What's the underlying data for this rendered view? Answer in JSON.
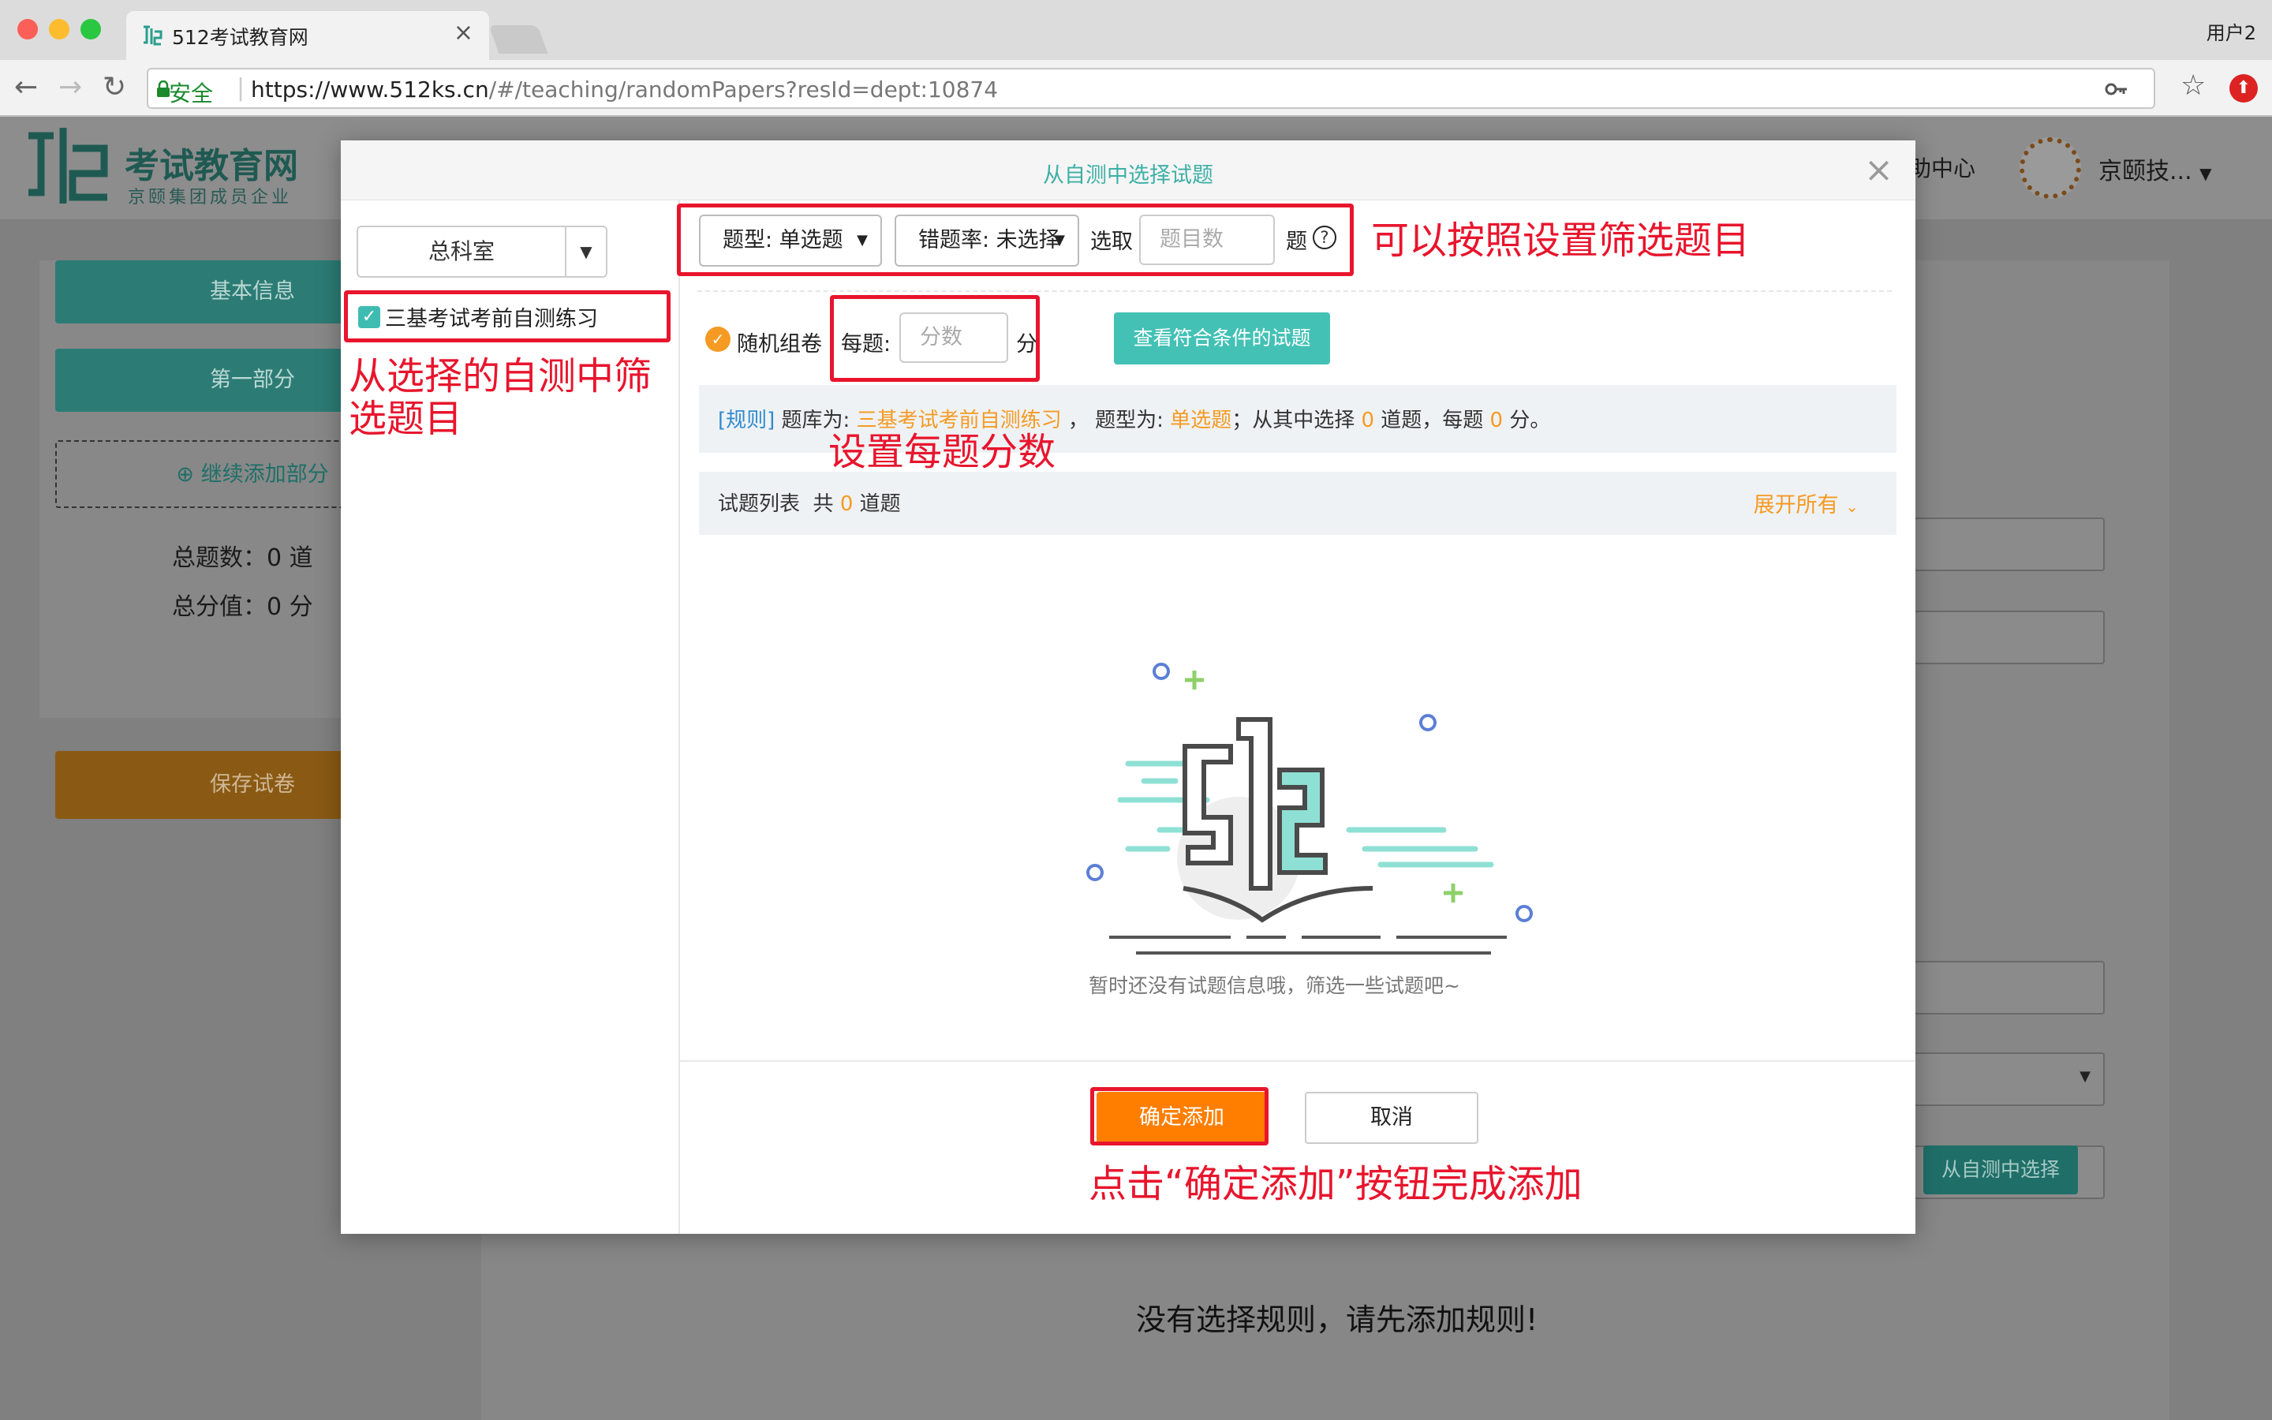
{
  "browser": {
    "tab_title": "512考试教育网",
    "user_label": "用户2",
    "secure_label": "安全",
    "url_host": "https://www.512ks.cn",
    "url_path": "/#/teaching/randomPapers?resId=dept:10874"
  },
  "header": {
    "logo_title": "考试教育网",
    "logo_subtitle": "京颐集团成员企业",
    "help_label": "助中心",
    "user_name": "京颐技..."
  },
  "left_panel": {
    "basic_info": "基本信息",
    "part_one": "第一部分",
    "add_part": "⊕ 继续添加部分",
    "total_questions": "总题数：0 道",
    "total_score": "总分值：0 分",
    "save_paper": "保存试卷"
  },
  "right_panel": {
    "select_from_self_test": "从自测中选择",
    "no_rule_msg": "没有选择规则，请先添加规则!"
  },
  "modal": {
    "title": "从自测中选择试题",
    "dept_select": "总科室",
    "bank_item": "三基考试考前自测练习",
    "filter_type": "题型: 单选题",
    "filter_error_rate": "错题率: 未选择",
    "pick_label": "选取",
    "pick_placeholder": "题目数",
    "pick_unit": "题",
    "random_label": "随机组卷",
    "each_label": "每题:",
    "score_placeholder": "分数",
    "score_unit": "分",
    "view_btn": "查看符合条件的试题",
    "rule_tag": "[规则]",
    "rule_bank_prefix": " 题库为: ",
    "rule_bank": "三基考试考前自测练习",
    "rule_type_prefix": " ， 题型为: ",
    "rule_type": "单选题",
    "rule_pick_prefix": "；从其中选择 ",
    "rule_count": "0",
    "rule_each_prefix": " 道题，每题 ",
    "rule_score": "0",
    "rule_suffix": " 分。",
    "list_title": "试题列表",
    "list_total_prefix": "共",
    "list_count": "0",
    "list_total_suffix": "道题",
    "expand_all": "展开所有",
    "empty_msg": "暂时还没有试题信息哦，筛选一些试题吧~",
    "confirm_btn": "确定添加",
    "cancel_btn": "取消"
  },
  "annotations": {
    "filter_note": "可以按照设置筛选题目",
    "bank_note": "从选择的自测中筛选题目",
    "score_note": "设置每题分数",
    "confirm_note": "点击“确定添加”按钮完成添加"
  },
  "colors": {
    "teal": "#3db0a6",
    "orange": "#ff7e00",
    "annotation_red": "#e8152d"
  }
}
